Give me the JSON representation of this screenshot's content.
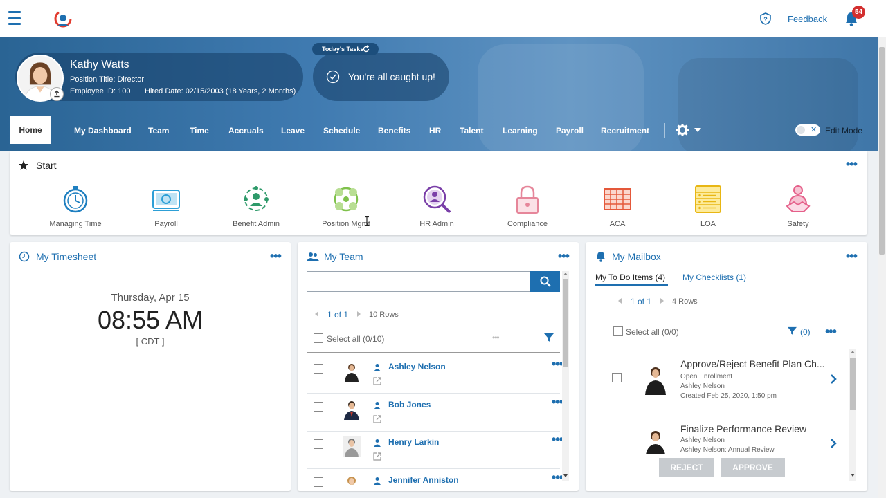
{
  "header": {
    "feedback_label": "Feedback",
    "notification_count": "54",
    "icons": [
      "menu-icon",
      "brand-logo",
      "help-icon",
      "bell-icon"
    ]
  },
  "profile": {
    "name": "Kathy Watts",
    "position": "Position Title: Director",
    "employee_id": "Employee ID: 100",
    "hired": "Hired Date: 02/15/2003 (18 Years, 2 Months)"
  },
  "tasks": {
    "tag": "Today's Tasks",
    "message": "You're all caught up!"
  },
  "nav": {
    "items": [
      "Home",
      "My Dashboard",
      "Team",
      "Time",
      "Accruals",
      "Leave",
      "Schedule",
      "Benefits",
      "HR",
      "Talent",
      "Learning",
      "Payroll",
      "Recruitment"
    ],
    "active": "Home",
    "edit_mode": "Edit Mode",
    "edit_mode_on": false
  },
  "start": {
    "title": "Start",
    "items": [
      {
        "label": "Managing Time",
        "icon": "stopwatch-icon",
        "color": "#1e7fc0"
      },
      {
        "label": "Payroll",
        "icon": "money-icon",
        "color": "#2d9fd6"
      },
      {
        "label": "Benefit Admin",
        "icon": "people-network-icon",
        "color": "#2e9a6a"
      },
      {
        "label": "Position Mgmt",
        "icon": "position-cycle-icon",
        "color": "#7fc14b"
      },
      {
        "label": "HR Admin",
        "icon": "search-person-icon",
        "color": "#7a3fa8"
      },
      {
        "label": "Compliance",
        "icon": "lock-icon",
        "color": "#e6869a"
      },
      {
        "label": "ACA",
        "icon": "grid-table-icon",
        "color": "#e4583a"
      },
      {
        "label": "LOA",
        "icon": "list-doc-icon",
        "color": "#e8b613"
      },
      {
        "label": "Safety",
        "icon": "handshake-person-icon",
        "color": "#e5608a"
      }
    ]
  },
  "timesheet": {
    "title": "My Timesheet",
    "date": "Thursday, Apr 15",
    "time": "08:55 AM",
    "zone": "[ CDT ]"
  },
  "team": {
    "title": "My Team",
    "search_placeholder": "",
    "page": "1 of 1",
    "rows": "10 Rows",
    "select_all": "Select all (0/10)",
    "members": [
      "Ashley Nelson",
      "Bob Jones",
      "Henry Larkin",
      "Jennifer Anniston"
    ]
  },
  "mailbox": {
    "title": "My Mailbox",
    "tab_todo": "My To Do Items (4)",
    "tab_checklists": "My Checklists (1)",
    "page": "1 of 1",
    "rows": "4 Rows",
    "select_all": "Select all (0/0)",
    "filter_count": "(0)",
    "items": [
      {
        "title": "Approve/Reject Benefit Plan Ch...",
        "line1": "Open Enrollment",
        "line2": "Ashley Nelson",
        "line3": "Created Feb 25, 2020, 1:50 pm"
      },
      {
        "title": "Finalize Performance Review",
        "line1": "Ashley Nelson",
        "line2": "Ashley Nelson: Annual Review",
        "line3": ""
      }
    ],
    "reject_label": "REJECT",
    "approve_label": "APPROVE"
  }
}
